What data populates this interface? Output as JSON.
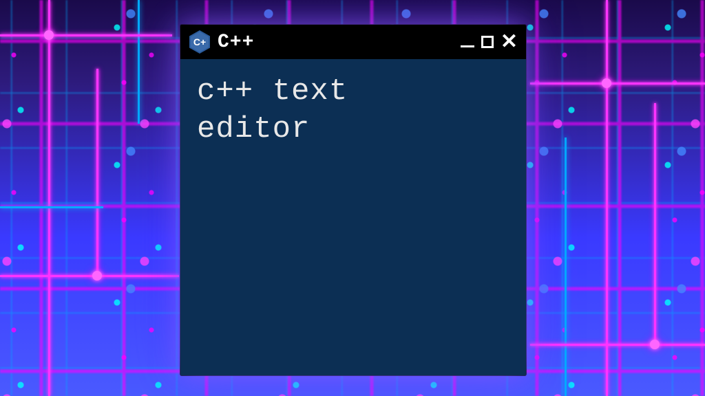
{
  "window": {
    "title": "C++",
    "icon_label": "C+",
    "icon_name": "cpp-hexagon-icon"
  },
  "editor": {
    "content": "c++ text\neditor"
  },
  "controls": {
    "minimize_name": "minimize",
    "maximize_name": "maximize",
    "close_name": "close"
  }
}
